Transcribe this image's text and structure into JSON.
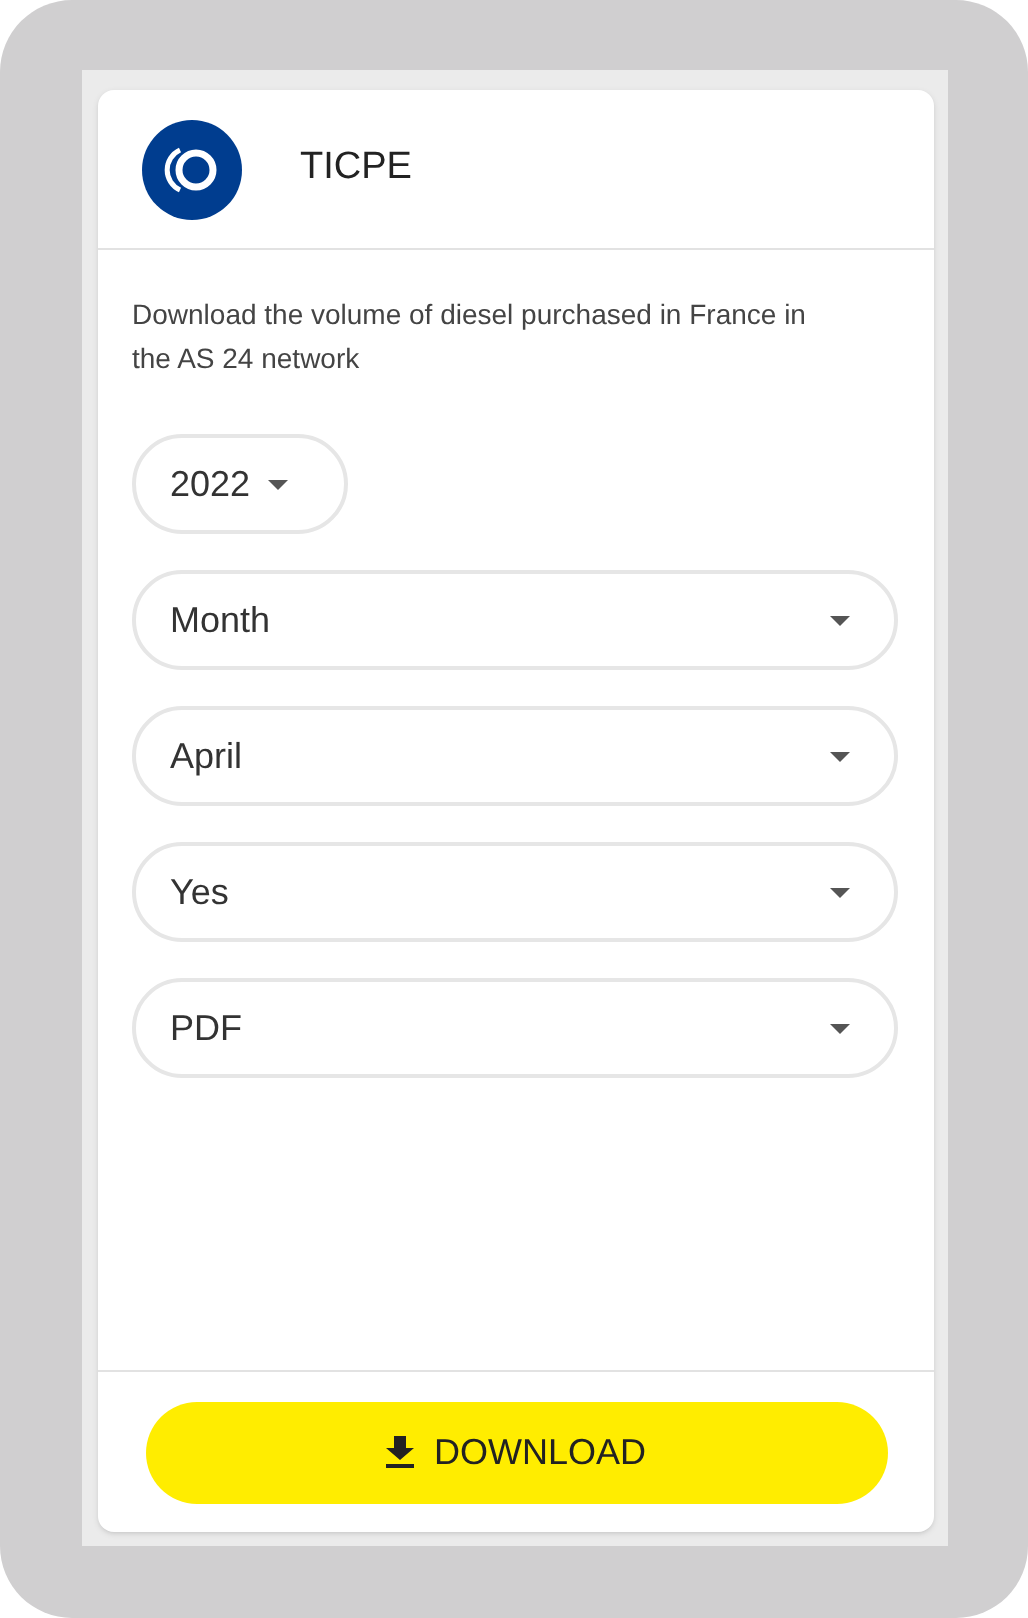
{
  "card": {
    "title": "TICPE",
    "description": "Download the volume of diesel purchased in France in the AS 24 network",
    "selects": [
      {
        "kind": "compact",
        "value": "2022"
      },
      {
        "kind": "full",
        "value": "Month"
      },
      {
        "kind": "full",
        "value": "April"
      },
      {
        "kind": "full",
        "value": "Yes"
      },
      {
        "kind": "full",
        "value": "PDF"
      }
    ],
    "download_button": "DOWNLOAD"
  }
}
